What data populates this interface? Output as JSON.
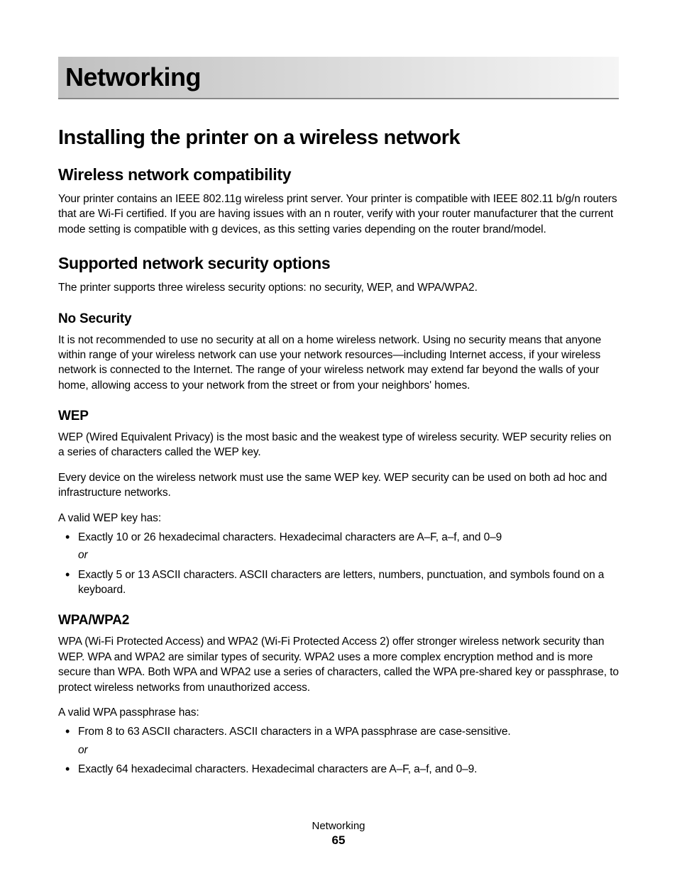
{
  "chapter": {
    "title": "Networking"
  },
  "section1": {
    "h1": "Installing the printer on a wireless network",
    "sub1": {
      "h2": "Wireless network compatibility",
      "p1": "Your printer contains an IEEE 802.11g wireless print server. Your printer is compatible with IEEE 802.11 b/g/n routers that are Wi-Fi certified. If you are having issues with an n router, verify with your router manufacturer that the current mode setting is compatible with g devices, as this setting varies depending on the router brand/model."
    },
    "sub2": {
      "h2": "Supported network security options",
      "p1": "The printer supports three wireless security options: no security, WEP, and WPA/WPA2.",
      "nosec": {
        "h3": "No Security",
        "p1": "It is not recommended to use no security at all on a home wireless network. Using no security means that anyone within range of your wireless network can use your network resources—including Internet access, if your wireless network is connected to the Internet. The range of your wireless network may extend far beyond the walls of your home, allowing access to your network from the street or from your neighbors' homes."
      },
      "wep": {
        "h3": "WEP",
        "p1": "WEP (Wired Equivalent Privacy) is the most basic and the weakest type of wireless security. WEP security relies on a series of characters called the WEP key.",
        "p2": "Every device on the wireless network must use the same WEP key. WEP security can be used on both ad hoc and infrastructure networks.",
        "p3": "A valid WEP key has:",
        "bullets": {
          "b1": "Exactly 10 or 26 hexadecimal characters. Hexadecimal characters are A–F, a–f, and 0–9",
          "or": "or",
          "b2": "Exactly 5 or 13 ASCII characters. ASCII characters are letters, numbers, punctuation, and symbols found on a keyboard."
        }
      },
      "wpa": {
        "h3": "WPA/WPA2",
        "p1": "WPA (Wi-Fi Protected Access) and WPA2 (Wi-Fi Protected Access 2) offer stronger wireless network security than WEP. WPA and WPA2 are similar types of security. WPA2 uses a more complex encryption method and is more secure than WPA. Both WPA and WPA2 use a series of characters, called the WPA pre-shared key or passphrase, to protect wireless networks from unauthorized access.",
        "p2": "A valid WPA passphrase has:",
        "bullets": {
          "b1": "From 8 to 63 ASCII characters. ASCII characters in a WPA passphrase are case-sensitive.",
          "or": "or",
          "b2": "Exactly 64 hexadecimal characters. Hexadecimal characters are A–F, a–f, and 0–9."
        }
      }
    }
  },
  "footer": {
    "section": "Networking",
    "page": "65"
  }
}
